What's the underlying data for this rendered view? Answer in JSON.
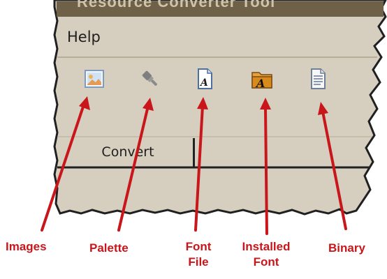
{
  "window": {
    "title_fragment": "Resource Converter Tool"
  },
  "menu": {
    "help_label": "Help"
  },
  "toolbar": {
    "buttons": [
      {
        "name": "images-button",
        "icon": "images-icon"
      },
      {
        "name": "palette-button",
        "icon": "palette-icon"
      },
      {
        "name": "font-file-button",
        "icon": "font-file-icon"
      },
      {
        "name": "installed-font-button",
        "icon": "installed-font-icon"
      },
      {
        "name": "binary-button",
        "icon": "binary-icon"
      }
    ]
  },
  "tabs": {
    "convert_label": "Convert"
  },
  "callouts": {
    "images": "Images",
    "palette": "Palette",
    "font_file": "Font\nFile",
    "installed_font": "Installed\nFont",
    "binary": "Binary"
  },
  "colors": {
    "panel_bg": "#d6cfbf",
    "panel_border": "#202020",
    "arrow": "#c8161b",
    "folder": "#d98a1c"
  }
}
